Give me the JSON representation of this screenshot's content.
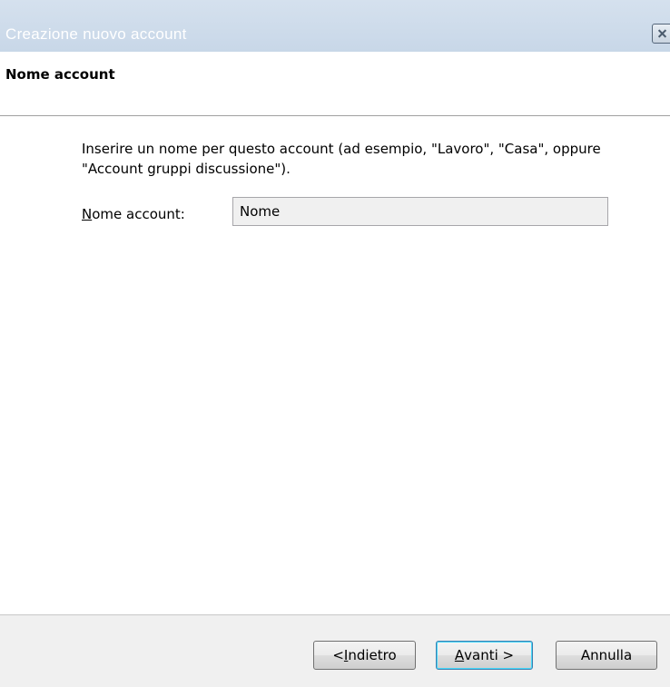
{
  "window": {
    "title": "Creazione nuovo account",
    "close_icon": "close-icon"
  },
  "header": {
    "title": "Nome account"
  },
  "main": {
    "instructions": "Inserire un nome per questo account (ad esempio, \"Lavoro\", \"Casa\", oppure \"Account gruppi discussione\").",
    "field_label_mnemonic": "N",
    "field_label_rest": "ome account:",
    "field_value": "Nome"
  },
  "footer": {
    "back_prefix": "< ",
    "back_mnemonic": "I",
    "back_rest": "ndietro",
    "next_mnemonic": "A",
    "next_rest": "vanti >",
    "cancel_label": "Annulla"
  }
}
